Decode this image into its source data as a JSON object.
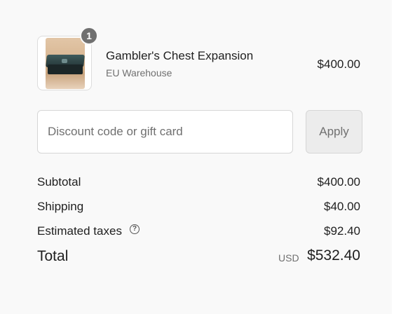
{
  "cart": {
    "item": {
      "quantity": "1",
      "name": "Gambler's Chest Expansion",
      "variant": "EU Warehouse",
      "price": "$400.00"
    }
  },
  "discount": {
    "placeholder": "Discount code or gift card",
    "value": "",
    "apply_label": "Apply"
  },
  "summary": {
    "subtotal_label": "Subtotal",
    "subtotal_value": "$400.00",
    "shipping_label": "Shipping",
    "shipping_value": "$40.00",
    "taxes_label": "Estimated taxes",
    "taxes_icon": "?",
    "taxes_value": "$92.40",
    "total_label": "Total",
    "currency": "USD",
    "total_value": "$532.40"
  }
}
